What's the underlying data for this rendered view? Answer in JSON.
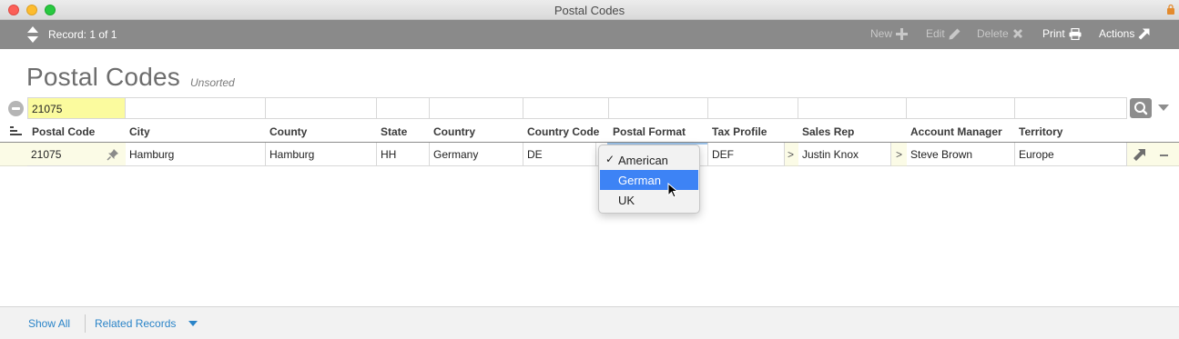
{
  "window": {
    "title": "Postal Codes"
  },
  "toolbar": {
    "record_label": "Record: 1 of 1",
    "new_label": "New",
    "edit_label": "Edit",
    "delete_label": "Delete",
    "print_label": "Print",
    "actions_label": "Actions"
  },
  "header": {
    "title": "Postal Codes",
    "sort_status": "Unsorted"
  },
  "find": {
    "postal_code": "21075"
  },
  "columns": [
    "Postal Code",
    "City",
    "County",
    "State",
    "Country",
    "Country Code",
    "Postal Format",
    "Tax Profile",
    "Sales Rep",
    "Account Manager",
    "Territory"
  ],
  "row": {
    "postal_code": "21075",
    "city": "Hamburg",
    "county": "Hamburg",
    "state": "HH",
    "country": "Germany",
    "country_code": "DE",
    "postal_format": "",
    "tax_profile": "DEF",
    "sales_rep": "Justin Knox",
    "account_manager": "Steve Brown",
    "territory": "Europe"
  },
  "popup": {
    "options": [
      "American",
      "German",
      "UK"
    ],
    "checked": "American",
    "highlighted": "German",
    "check_mark": "✓"
  },
  "footer": {
    "show_all": "Show All",
    "related_records": "Related Records"
  },
  "colors": {
    "toolbar_bg": "#8a8a8a",
    "find_highlight": "#fbfb9e",
    "menu_highlight": "#3d83f5",
    "link": "#2a84c8"
  }
}
